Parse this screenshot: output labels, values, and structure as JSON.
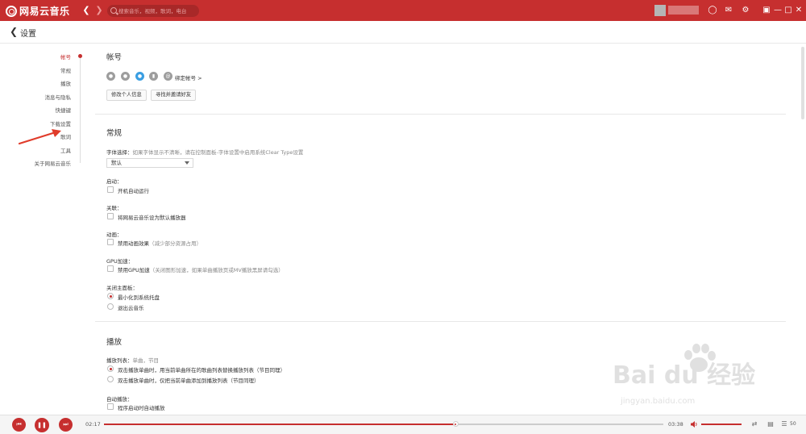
{
  "app": {
    "logo_text": "网易云音乐"
  },
  "search": {
    "placeholder": "搜索音乐，视频，歌词，电台"
  },
  "header": {
    "title": "设置"
  },
  "nav": {
    "items": [
      {
        "label": "帐号"
      },
      {
        "label": "常规"
      },
      {
        "label": "播放"
      },
      {
        "label": "消息与隐私"
      },
      {
        "label": "快捷键"
      },
      {
        "label": "下载设置"
      },
      {
        "label": "歌词"
      },
      {
        "label": "工具"
      },
      {
        "label": "关于网易云音乐"
      }
    ]
  },
  "account": {
    "title": "帐号",
    "bind_label": "绑定帐号 >",
    "edit_profile": "修改个人信息",
    "invite_friends": "寻找并邀请好友"
  },
  "general": {
    "title": "常规",
    "font_label": "字体选择：",
    "font_hint": "如果字体显示不清晰，请在控制面板-字体设置中启用系统Clear Type设置",
    "font_value": "默认",
    "startup_label": "启动：",
    "startup_option": "开机自动运行",
    "assoc_label": "关联：",
    "assoc_option": "将网易云音乐设为默认播放器",
    "anim_label": "动画：",
    "anim_option": "禁用动画效果",
    "anim_hint": "（减少部分资源占用）",
    "gpu_label": "GPU加速：",
    "gpu_option": "禁用GPU加速",
    "gpu_hint": "（关闭图形加速，如果单曲播放页或MV播放黑屏请勾选）",
    "close_label": "关闭主面板：",
    "close_opt1": "最小化到系统托盘",
    "close_opt2": "退出云音乐"
  },
  "playback": {
    "title": "播放",
    "list_label": "播放列表：",
    "list_hint": "单曲，节目",
    "list_opt1": "双击播放单曲时，用当前单曲所在的歌曲列表替换播放列表（节目同理）",
    "list_opt2": "双击播放单曲时，仅把当前单曲添加到播放列表（节目同理）",
    "auto_label": "自动播放：",
    "auto_option": "程序启动时自动播放"
  },
  "player": {
    "current_time": "02:17",
    "total_time": "03:38",
    "progress": 0.628,
    "volume": 1.0,
    "count": "50"
  },
  "watermark": {
    "text": "Bai du 经验",
    "url": "jingyan.baidu.com"
  },
  "colors": {
    "accent": "#c62f2f",
    "topbar": "#c62f2f"
  }
}
